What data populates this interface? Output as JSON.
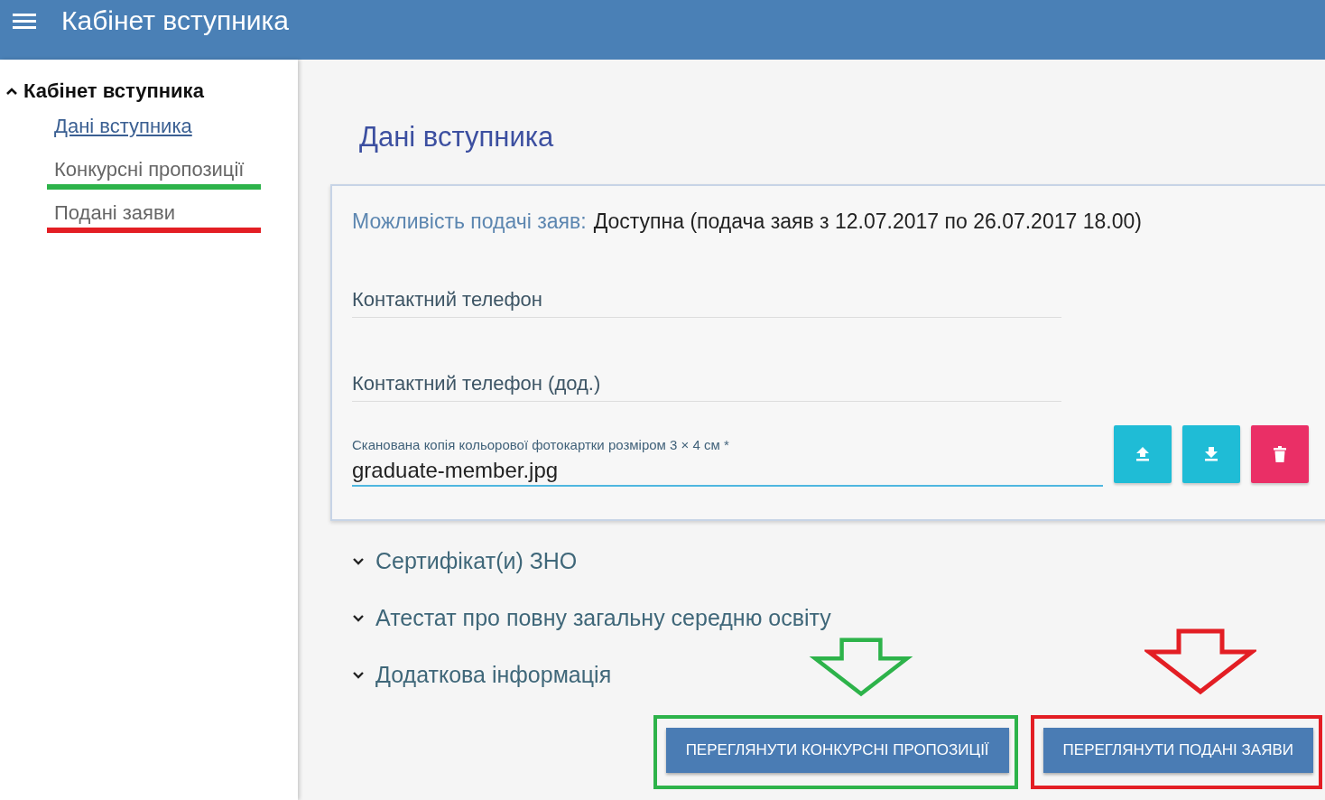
{
  "app_bar": {
    "title": "Кабінет вступника"
  },
  "sidebar": {
    "group": {
      "label": "Кабінет вступника",
      "expanded": true
    },
    "items": [
      {
        "label": "Дані вступника",
        "selected": true
      },
      {
        "label": "Конкурсні пропозиції",
        "selected": false,
        "color": "#2db34a"
      },
      {
        "label": "Подані заяви",
        "selected": false,
        "color": "#e31e24"
      }
    ]
  },
  "page_title": "Дані вступника",
  "card": {
    "availability_label": "Можливість подачі заяв:",
    "availability_value": "Доступна (подача заяв з 12.07.2017 по 26.07.2017 18.00)",
    "fields": [
      {
        "placeholder": "Контактний телефон"
      },
      {
        "placeholder": "Контактний телефон (дод.)"
      }
    ],
    "file_field": {
      "label": "Сканована копія кольорової фотокартки розміром 3 × 4 см *",
      "value": "graduate-member.jpg"
    },
    "file_actions": [
      {
        "kind": "upload"
      },
      {
        "kind": "download"
      },
      {
        "kind": "delete"
      }
    ]
  },
  "sections": [
    {
      "label": "Сертифікат(и) ЗНО",
      "expanded": false
    },
    {
      "label": "Атестат про повну загальну середню освіту",
      "expanded": false
    },
    {
      "label": "Додаткова інформація",
      "expanded": false
    }
  ],
  "buttons": [
    {
      "label": "ПЕРЕГЛЯНУТИ КОНКУРСНІ ПРОПОЗИЦІЇ",
      "color": "#2db34a"
    },
    {
      "label": "ПЕРЕГЛЯНУТИ ПОДАНІ ЗАЯВИ",
      "color": "#e31e24"
    }
  ]
}
